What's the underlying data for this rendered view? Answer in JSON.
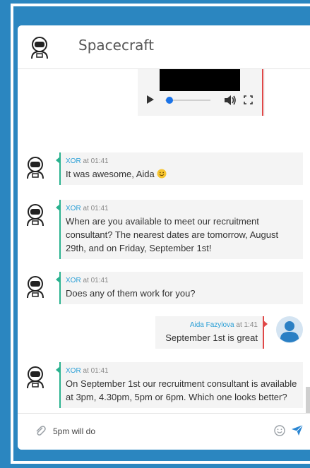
{
  "header": {
    "title": "Spacecraft"
  },
  "messages": [
    {
      "author": "XOR",
      "at_label": "at",
      "time": "01:41",
      "text": "It was awesome, Aida"
    },
    {
      "author": "XOR",
      "at_label": "at",
      "time": "01:41",
      "text": "When are you available to meet our recruitment consultant? The nearest dates are tomorrow, August 29th, and on Friday, September 1st!"
    },
    {
      "author": "XOR",
      "at_label": "at",
      "time": "01:41",
      "text": "Does any of them work for you?"
    },
    {
      "author": "Aida Fazylova",
      "at_label": "at",
      "time": "1:41",
      "text": "September 1st is great"
    },
    {
      "author": "XOR",
      "at_label": "at",
      "time": "01:41",
      "text": "On September 1st our recruitment consultant is available at 3pm, 4.30pm, 5pm or 6pm. Which one looks better?"
    }
  ],
  "composer": {
    "value": "5pm will do"
  },
  "colors": {
    "background": "#2b86c0",
    "bot_accent": "#2ab28f",
    "user_accent": "#e04848",
    "link": "#2a9fd6"
  },
  "icons": [
    "astronaut-avatar-icon",
    "play-icon",
    "volume-icon",
    "fullscreen-icon",
    "smile-emoji-icon",
    "user-avatar-icon",
    "paperclip-icon",
    "emoji-icon",
    "send-icon"
  ]
}
